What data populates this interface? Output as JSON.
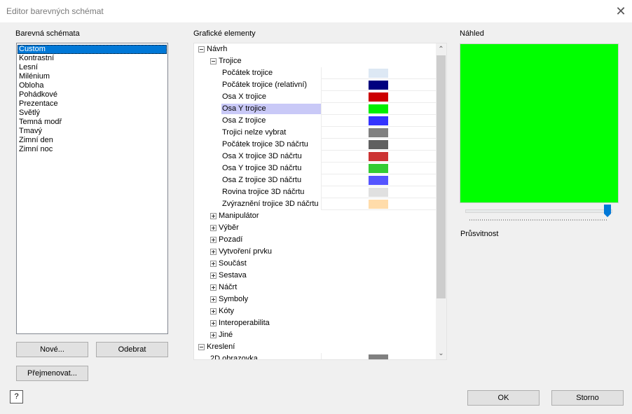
{
  "window": {
    "title": "Editor barevných schémat"
  },
  "schemes": {
    "label": "Barevná schémata",
    "items": [
      "Custom",
      "Kontrastní",
      "Lesní",
      "Milénium",
      "Obloha",
      "Pohádkové",
      "Prezentace",
      "Světlý",
      "Temná modř",
      "Tmavý",
      "Zimní den",
      "Zimní noc"
    ],
    "selected": "Custom",
    "new_label": "Nové...",
    "remove_label": "Odebrat",
    "rename_label": "Přejmenovat..."
  },
  "elements": {
    "label": "Grafické elementy",
    "rows": [
      {
        "text": "Návrh",
        "level": 0,
        "expander": "minus"
      },
      {
        "text": "Trojice",
        "level": 1,
        "expander": "minus"
      },
      {
        "text": "Počátek trojice",
        "level": 2,
        "color": "#dde8f4"
      },
      {
        "text": "Počátek trojice (relativní)",
        "level": 2,
        "color": "#00007f"
      },
      {
        "text": "Osa X trojice",
        "level": 2,
        "color": "#cc0000"
      },
      {
        "text": "Osa Y trojice",
        "level": 2,
        "color": "#00ee00",
        "selected": true
      },
      {
        "text": "Osa Z trojice",
        "level": 2,
        "color": "#3333ff"
      },
      {
        "text": "Trojici nelze vybrat",
        "level": 2,
        "color": "#808080"
      },
      {
        "text": "Počátek trojice 3D náčrtu",
        "level": 2,
        "color": "#606060"
      },
      {
        "text": "Osa X trojice 3D náčrtu",
        "level": 2,
        "color": "#cc3333"
      },
      {
        "text": "Osa Y trojice 3D náčrtu",
        "level": 2,
        "color": "#33cc33"
      },
      {
        "text": "Osa Z trojice 3D náčrtu",
        "level": 2,
        "color": "#5555ff"
      },
      {
        "text": "Rovina trojice 3D náčrtu",
        "level": 2,
        "color": "#e0e0e0"
      },
      {
        "text": "Zvýraznění trojice 3D náčrtu",
        "level": 2,
        "color": "#ffdcaa"
      },
      {
        "text": "Manipulátor",
        "level": 1,
        "expander": "plus"
      },
      {
        "text": "Výběr",
        "level": 1,
        "expander": "plus"
      },
      {
        "text": "Pozadí",
        "level": 1,
        "expander": "plus"
      },
      {
        "text": "Vytvoření prvku",
        "level": 1,
        "expander": "plus"
      },
      {
        "text": "Součást",
        "level": 1,
        "expander": "plus"
      },
      {
        "text": "Sestava",
        "level": 1,
        "expander": "plus"
      },
      {
        "text": "Náčrt",
        "level": 1,
        "expander": "plus"
      },
      {
        "text": "Symboly",
        "level": 1,
        "expander": "plus"
      },
      {
        "text": "Kóty",
        "level": 1,
        "expander": "plus"
      },
      {
        "text": "Interoperabilita",
        "level": 1,
        "expander": "plus"
      },
      {
        "text": "Jiné",
        "level": 1,
        "expander": "plus"
      },
      {
        "text": "Kreslení",
        "level": 0,
        "expander": "minus"
      },
      {
        "text": "2D obrazovka",
        "level": 1,
        "color": "#808080"
      }
    ]
  },
  "preview": {
    "label": "Náhled",
    "color": "#00ff00",
    "transparency_label": "Průsvitnost",
    "transparency_value": 1.0
  },
  "footer": {
    "help_glyph": "?",
    "ok_label": "OK",
    "cancel_label": "Storno"
  },
  "icons": {
    "close": "close-icon",
    "help": "help-icon",
    "scroll_up": "chevron-up-icon",
    "scroll_down": "chevron-down-icon"
  }
}
